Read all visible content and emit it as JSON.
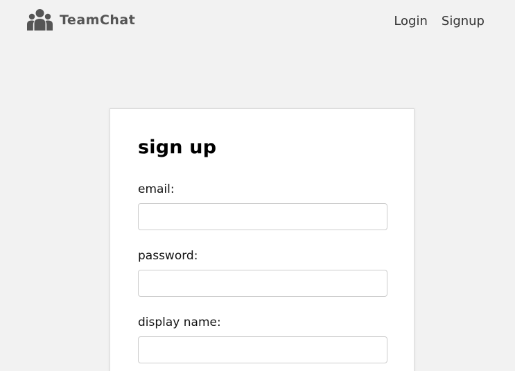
{
  "navbar": {
    "brand_icon": "users-group-icon",
    "brand_name": "TeamChat",
    "links": [
      {
        "label": "Login"
      },
      {
        "label": "Signup"
      }
    ]
  },
  "form": {
    "title": "sign up",
    "fields": [
      {
        "label": "email:",
        "value": "",
        "placeholder": ""
      },
      {
        "label": "password:",
        "value": "",
        "placeholder": ""
      },
      {
        "label": "display name:",
        "value": "",
        "placeholder": ""
      }
    ]
  },
  "colors": {
    "background": "#f2f2f2",
    "card": "#ffffff",
    "brand_text": "#555555",
    "icon": "#555555",
    "input_border": "#cccccc"
  }
}
